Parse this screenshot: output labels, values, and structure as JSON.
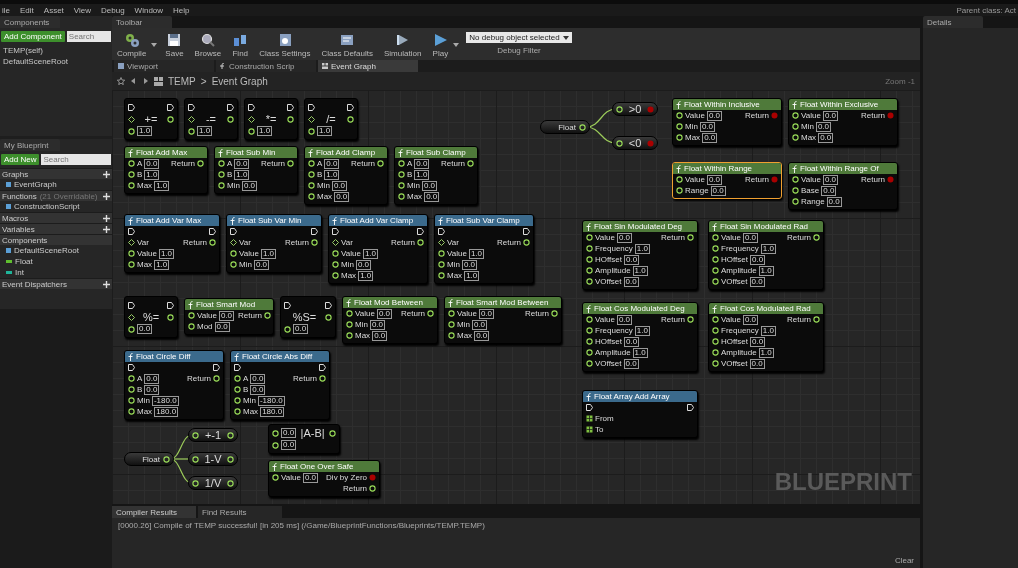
{
  "menu": [
    "ile",
    "Edit",
    "Asset",
    "View",
    "Debug",
    "Window",
    "Help"
  ],
  "parent_class": "Parent class: Act",
  "components": {
    "tab": "Components",
    "add_button": "Add Component",
    "search": {
      "placeholder": "Search"
    },
    "tree": [
      {
        "label": "TEMP(self)"
      },
      {
        "label": "DefaultSceneRoot"
      }
    ]
  },
  "my_blueprint": {
    "tab": "My Blueprint",
    "add_button": "Add New",
    "search": {
      "placeholder": "Search"
    },
    "sections": [
      {
        "title": "Graphs",
        "add": true,
        "items": [
          {
            "label": "EventGraph"
          }
        ]
      },
      {
        "title": "Functions",
        "note": "(21 Overridable)",
        "add": true,
        "items": [
          {
            "label": "ConstructionScript"
          }
        ]
      },
      {
        "title": "Macros",
        "add": true
      },
      {
        "title": "Variables",
        "add": true
      },
      {
        "title": "Components",
        "add": false,
        "items": [
          {
            "label": "DefaultSceneRoot"
          },
          {
            "label": "Float",
            "color": "#5fbf2f"
          },
          {
            "label": "Int",
            "color": "#1fb59a"
          }
        ]
      },
      {
        "title": "Event Dispatchers",
        "add": true
      }
    ]
  },
  "toolbar": {
    "tab": "Toolbar",
    "buttons": [
      {
        "label": "Compile",
        "dropdown": true
      },
      {
        "label": "Save",
        "dropdown": false
      },
      {
        "label": "Browse",
        "dropdown": false
      },
      {
        "label": "Find",
        "dropdown": false
      },
      {
        "label": "Class Settings",
        "dropdown": false
      },
      {
        "label": "Class Defaults",
        "dropdown": false
      },
      {
        "label": "Simulation",
        "dropdown": false
      },
      {
        "label": "Play",
        "dropdown": true
      }
    ],
    "debug_filter": {
      "value": "No debug object selected",
      "label": "Debug Filter"
    }
  },
  "document_tabs": [
    {
      "label": "Viewport",
      "selected": false
    },
    {
      "label": "Construction Scrip",
      "selected": false
    },
    {
      "label": "Event Graph",
      "selected": true
    }
  ],
  "breadcrumb": {
    "root": "TEMP",
    "separator": ">",
    "current": "Event Graph",
    "zoom": "Zoom -1"
  },
  "graph": {
    "watermark": "BLUEPRINT",
    "nodes": [
      {
        "kind": "op",
        "symbol": "+=",
        "exec": true,
        "target": true,
        "values": [
          "1.0"
        ]
      },
      {
        "kind": "op",
        "symbol": "-=",
        "exec": true,
        "target": true,
        "values": [
          "1.0"
        ]
      },
      {
        "kind": "op",
        "symbol": "*=",
        "exec": true,
        "target": true,
        "values": [
          "1.0"
        ]
      },
      {
        "kind": "op",
        "symbol": "/=",
        "exec": true,
        "target": true,
        "values": [
          "1.0"
        ]
      },
      {
        "kind": "function",
        "title": "Float Add Max",
        "color": "#4f7a3a",
        "exec": false,
        "selected": false,
        "inputs": [
          {
            "label": "A",
            "value": "0.0"
          },
          {
            "label": "B",
            "value": "1.0"
          },
          {
            "label": "Max",
            "value": "1.0"
          }
        ],
        "outputs": [
          {
            "label": "Return",
            "kind": "float"
          }
        ]
      },
      {
        "kind": "function",
        "title": "Float Sub Min",
        "color": "#4f7a3a",
        "exec": false,
        "selected": false,
        "inputs": [
          {
            "label": "A",
            "value": "0.0"
          },
          {
            "label": "B",
            "value": "1.0"
          },
          {
            "label": "Min",
            "value": "0.0"
          }
        ],
        "outputs": [
          {
            "label": "Return",
            "kind": "float"
          }
        ]
      },
      {
        "kind": "function",
        "title": "Float Add Clamp",
        "color": "#4f7a3a",
        "exec": false,
        "selected": false,
        "inputs": [
          {
            "label": "A",
            "value": "0.0"
          },
          {
            "label": "B",
            "value": "1.0"
          },
          {
            "label": "Min",
            "value": "0.0"
          },
          {
            "label": "Max",
            "value": "0.0"
          }
        ],
        "outputs": [
          {
            "label": "Return",
            "kind": "float"
          }
        ]
      },
      {
        "kind": "function",
        "title": "Float Sub Clamp",
        "color": "#4f7a3a",
        "exec": false,
        "selected": false,
        "inputs": [
          {
            "label": "A",
            "value": "0.0"
          },
          {
            "label": "B",
            "value": "1.0"
          },
          {
            "label": "Min",
            "value": "0.0"
          },
          {
            "label": "Max",
            "value": "0.0"
          }
        ],
        "outputs": [
          {
            "label": "Return",
            "kind": "float"
          }
        ]
      },
      {
        "kind": "function",
        "title": "Float Add Var Max",
        "color": "#3b6a8c",
        "exec": true,
        "selected": false,
        "inputs": [
          {
            "label": "Var",
            "kind": "ref"
          },
          {
            "label": "Value",
            "value": "1.0"
          },
          {
            "label": "Max",
            "value": "1.0"
          }
        ],
        "outputs": [
          {
            "label": "Return",
            "kind": "float"
          }
        ]
      },
      {
        "kind": "function",
        "title": "Float Sub Var Min",
        "color": "#3b6a8c",
        "exec": true,
        "selected": false,
        "inputs": [
          {
            "label": "Var",
            "kind": "ref"
          },
          {
            "label": "Value",
            "value": "1.0"
          },
          {
            "label": "Min",
            "value": "0.0"
          }
        ],
        "outputs": [
          {
            "label": "Return",
            "kind": "float"
          }
        ]
      },
      {
        "kind": "function",
        "title": "Float Add Var Clamp",
        "color": "#3b6a8c",
        "exec": true,
        "selected": false,
        "inputs": [
          {
            "label": "Var",
            "kind": "ref"
          },
          {
            "label": "Value",
            "value": "1.0"
          },
          {
            "label": "Min",
            "value": "0.0"
          },
          {
            "label": "Max",
            "value": "1.0"
          }
        ],
        "outputs": [
          {
            "label": "Return",
            "kind": "float"
          }
        ]
      },
      {
        "kind": "function",
        "title": "Float Sub Var Clamp",
        "color": "#3b6a8c",
        "exec": true,
        "selected": false,
        "inputs": [
          {
            "label": "Var",
            "kind": "ref"
          },
          {
            "label": "Value",
            "value": "1.0"
          },
          {
            "label": "Min",
            "value": "0.0"
          },
          {
            "label": "Max",
            "value": "1.0"
          }
        ],
        "outputs": [
          {
            "label": "Return",
            "kind": "float"
          }
        ]
      },
      {
        "kind": "split",
        "label": "Float",
        "branches": [
          {
            "symbol": ">0",
            "kind": "bool"
          },
          {
            "symbol": "<0",
            "kind": "bool"
          }
        ]
      },
      {
        "kind": "function",
        "title": "Float Within Inclusive",
        "color": "#4f7a3a",
        "exec": false,
        "selected": false,
        "inputs": [
          {
            "label": "Value",
            "value": "0.0"
          },
          {
            "label": "Min",
            "value": "0.0"
          },
          {
            "label": "Max",
            "value": "0.0"
          }
        ],
        "outputs": [
          {
            "label": "Return",
            "kind": "bool"
          }
        ]
      },
      {
        "kind": "function",
        "title": "Float Within Exclusive",
        "color": "#4f7a3a",
        "exec": false,
        "selected": false,
        "inputs": [
          {
            "label": "Value",
            "value": "0.0"
          },
          {
            "label": "Min",
            "value": "0.0"
          },
          {
            "label": "Max",
            "value": "0.0"
          }
        ],
        "outputs": [
          {
            "label": "Return",
            "kind": "bool"
          }
        ]
      },
      {
        "kind": "function",
        "title": "Float Within Range",
        "color": "#4f7a3a",
        "exec": false,
        "selected": true,
        "inputs": [
          {
            "label": "Value",
            "value": "0.0"
          },
          {
            "label": "Range",
            "value": "0.0"
          }
        ],
        "outputs": [
          {
            "label": "Return",
            "kind": "bool"
          }
        ]
      },
      {
        "kind": "function",
        "title": "Float Within Range Of",
        "color": "#4f7a3a",
        "exec": false,
        "selected": false,
        "inputs": [
          {
            "label": "Value",
            "value": "0.0"
          },
          {
            "label": "Base",
            "value": "0.0"
          },
          {
            "label": "Range",
            "value": "0.0"
          }
        ],
        "outputs": [
          {
            "label": "Return",
            "kind": "bool"
          }
        ]
      },
      {
        "kind": "op",
        "symbol": "%=",
        "exec": true,
        "target": true,
        "values": [
          "0.0"
        ]
      },
      {
        "kind": "function",
        "title": "Float Smart Mod",
        "color": "#4f7a3a",
        "exec": false,
        "selected": false,
        "inputs": [
          {
            "label": "Value",
            "value": "0.0"
          },
          {
            "label": "Mod",
            "value": "0.0"
          }
        ],
        "outputs": [
          {
            "label": "Return",
            "kind": "float"
          }
        ]
      },
      {
        "kind": "op",
        "symbol": "%S=",
        "exec": true,
        "target": false,
        "values": [
          "0.0"
        ]
      },
      {
        "kind": "function",
        "title": "Float Mod Between",
        "color": "#4f7a3a",
        "exec": false,
        "selected": false,
        "inputs": [
          {
            "label": "Value",
            "value": "0.0"
          },
          {
            "label": "Min",
            "value": "0.0"
          },
          {
            "label": "Max",
            "value": "0.0"
          }
        ],
        "outputs": [
          {
            "label": "Return",
            "kind": "float"
          }
        ]
      },
      {
        "kind": "function",
        "title": "Float Smart Mod Between",
        "color": "#4f7a3a",
        "exec": false,
        "selected": false,
        "inputs": [
          {
            "label": "Value",
            "value": "0.0"
          },
          {
            "label": "Min",
            "value": "0.0"
          },
          {
            "label": "Max",
            "value": "0.0"
          }
        ],
        "outputs": [
          {
            "label": "Return",
            "kind": "float"
          }
        ]
      },
      {
        "kind": "function",
        "title": "Float Circle Diff",
        "color": "#3b6a8c",
        "exec": true,
        "selected": false,
        "inputs": [
          {
            "label": "A",
            "value": "0.0"
          },
          {
            "label": "B",
            "value": "0.0"
          },
          {
            "label": "Min",
            "value": "-180.0"
          },
          {
            "label": "Max",
            "value": "180.0"
          }
        ],
        "outputs": [
          {
            "label": "Return",
            "kind": "float"
          }
        ]
      },
      {
        "kind": "function",
        "title": "Float Circle Abs Diff",
        "color": "#3b6a8c",
        "exec": true,
        "selected": false,
        "inputs": [
          {
            "label": "A",
            "value": "0.0"
          },
          {
            "label": "B",
            "value": "0.0"
          },
          {
            "label": "Min",
            "value": "-180.0"
          },
          {
            "label": "Max",
            "value": "180.0"
          }
        ],
        "outputs": [
          {
            "label": "Return",
            "kind": "float"
          }
        ]
      },
      {
        "kind": "function",
        "title": "Float Sin Modulated Deg",
        "color": "#4f7a3a",
        "exec": false,
        "selected": false,
        "inputs": [
          {
            "label": "Value",
            "value": "0.0"
          },
          {
            "label": "Frequency",
            "value": "1.0"
          },
          {
            "label": "HOffset",
            "value": "0.0"
          },
          {
            "label": "Amplitude",
            "value": "1.0"
          },
          {
            "label": "VOffset",
            "value": "0.0"
          }
        ],
        "outputs": [
          {
            "label": "Return",
            "kind": "float"
          }
        ]
      },
      {
        "kind": "function",
        "title": "Float Sin Modulated Rad",
        "color": "#4f7a3a",
        "exec": false,
        "selected": false,
        "inputs": [
          {
            "label": "Value",
            "value": "0.0"
          },
          {
            "label": "Frequency",
            "value": "1.0"
          },
          {
            "label": "HOffset",
            "value": "0.0"
          },
          {
            "label": "Amplitude",
            "value": "1.0"
          },
          {
            "label": "VOffset",
            "value": "0.0"
          }
        ],
        "outputs": [
          {
            "label": "Return",
            "kind": "float"
          }
        ]
      },
      {
        "kind": "function",
        "title": "Float Cos Modulated Deg",
        "color": "#4f7a3a",
        "exec": false,
        "selected": false,
        "inputs": [
          {
            "label": "Value",
            "value": "0.0"
          },
          {
            "label": "Frequency",
            "value": "1.0"
          },
          {
            "label": "HOffset",
            "value": "0.0"
          },
          {
            "label": "Amplitude",
            "value": "1.0"
          },
          {
            "label": "VOffset",
            "value": "0.0"
          }
        ],
        "outputs": [
          {
            "label": "Return",
            "kind": "float"
          }
        ]
      },
      {
        "kind": "function",
        "title": "Float Cos Modulated Rad",
        "color": "#4f7a3a",
        "exec": false,
        "selected": false,
        "inputs": [
          {
            "label": "Value",
            "value": "0.0"
          },
          {
            "label": "Frequency",
            "value": "1.0"
          },
          {
            "label": "HOffset",
            "value": "0.0"
          },
          {
            "label": "Amplitude",
            "value": "1.0"
          },
          {
            "label": "VOffset",
            "value": "0.0"
          }
        ],
        "outputs": [
          {
            "label": "Return",
            "kind": "float"
          }
        ]
      },
      {
        "kind": "split",
        "label": "Float",
        "branches": [
          {
            "symbol": "+-1",
            "kind": "float"
          },
          {
            "symbol": "1-V",
            "kind": "float"
          },
          {
            "symbol": "1/V",
            "kind": "float"
          }
        ]
      },
      {
        "kind": "op",
        "symbol": "|A-B|",
        "exec": false,
        "target": false,
        "values": [
          "0.0",
          "0.0"
        ]
      },
      {
        "kind": "function",
        "title": "Float One Over Safe",
        "color": "#4f7a3a",
        "exec": false,
        "selected": false,
        "inputs": [
          {
            "label": "Value",
            "value": "0.0"
          }
        ],
        "outputs": [
          {
            "label": "Div by Zero",
            "kind": "bool"
          },
          {
            "label": "Return",
            "kind": "float"
          }
        ]
      },
      {
        "kind": "function",
        "title": "Float Array Add Array",
        "color": "#3b6a8c",
        "exec": true,
        "selected": false,
        "inputs": [
          {
            "label": "From",
            "kind": "array"
          },
          {
            "label": "To",
            "kind": "array"
          }
        ]
      }
    ]
  },
  "details": {
    "tab": "Details"
  },
  "output_log": {
    "tabs": [
      {
        "label": "Compiler Results",
        "selected": true
      },
      {
        "label": "Find Results",
        "selected": false
      }
    ],
    "lines": [
      "[0000.26] Compile of TEMP successful! [in 205 ms] (/Game/BlueprintFunctions/Blueprints/TEMP.TEMP)"
    ],
    "clear_button": "Clear"
  }
}
